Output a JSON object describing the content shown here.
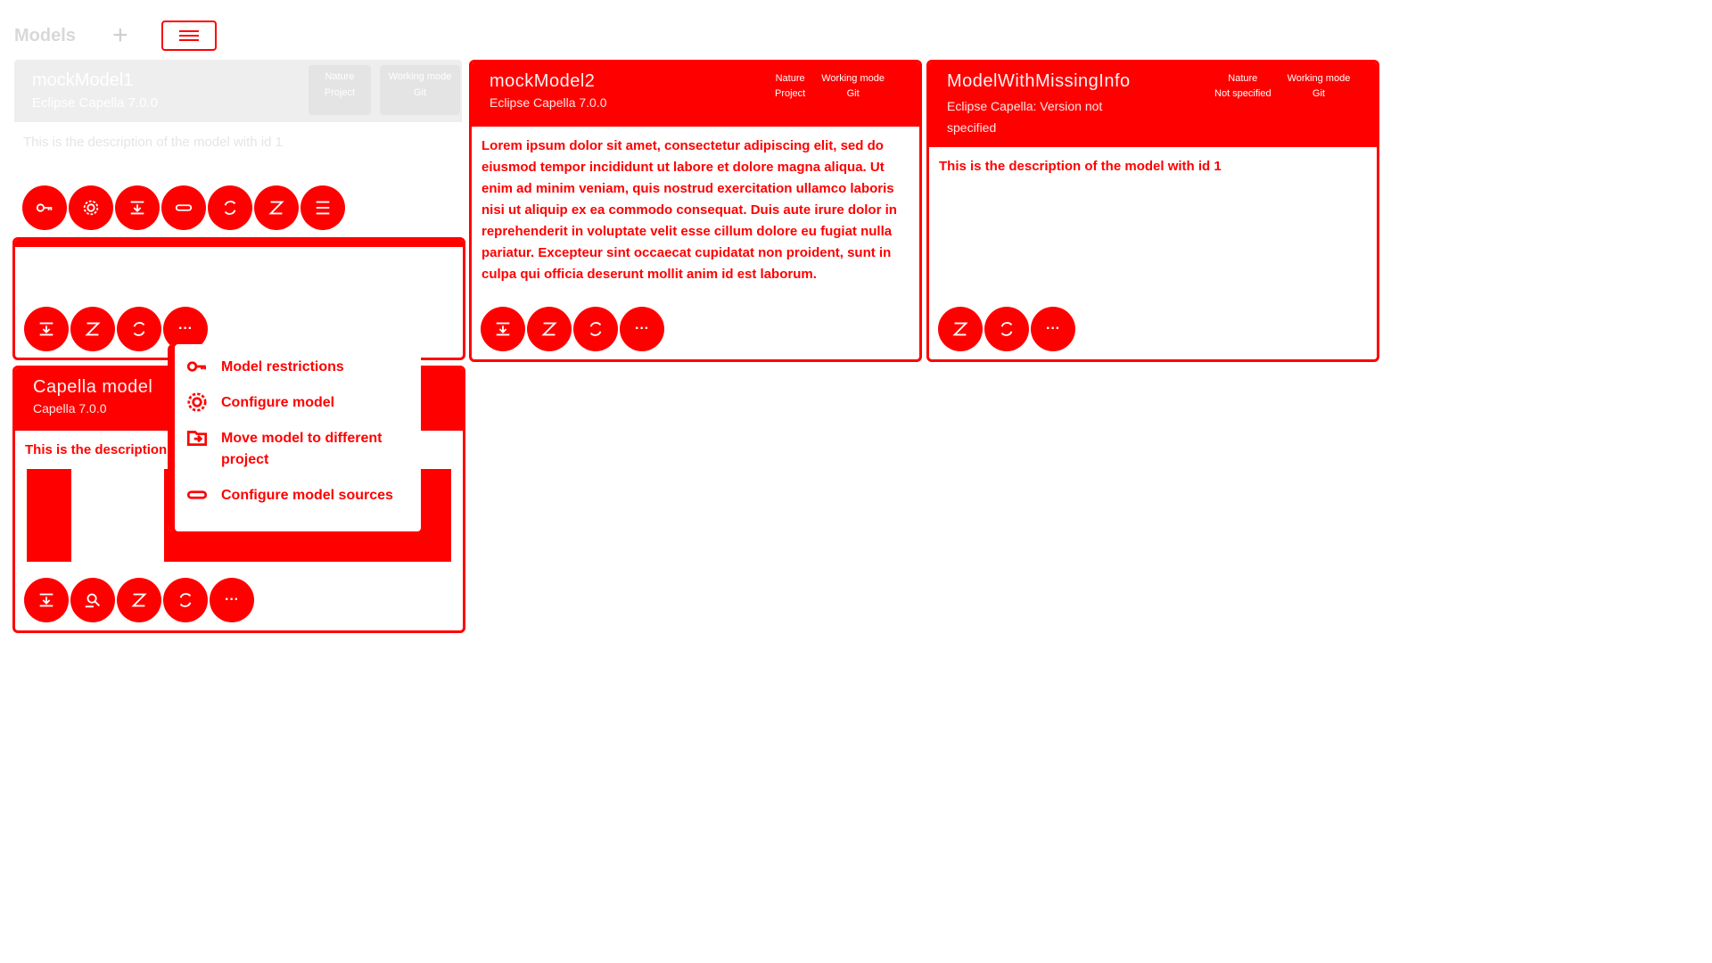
{
  "header": {
    "title": "Models",
    "add_label": "+"
  },
  "cards": [
    {
      "title": "mockModel1",
      "subtitle": "Eclipse Capella 7.0.0",
      "nature_label": "Nature",
      "nature_value": "Project",
      "mode_label": "Working mode",
      "mode_value": "Git",
      "description": "This is the description of the model with id 1"
    },
    {
      "title": "mockModel2",
      "subtitle": "Eclipse Capella 7.0.0",
      "nature_label": "Nature",
      "nature_value": "Project",
      "mode_label": "Working mode",
      "mode_value": "Git",
      "description": "Lorem ipsum dolor sit amet, consectetur adipiscing elit, sed do eiusmod tempor incididunt ut labore et dolore magna aliqua. Ut enim ad minim veniam, quis nostrud exercitation ullamco laboris nisi ut aliquip ex ea commodo consequat. Duis aute irure dolor in reprehenderit in voluptate velit esse cillum dolore eu fugiat nulla pariatur. Excepteur sint occaecat cupidatat non proident, sunt in culpa qui officia deserunt mollit anim id est laborum."
    },
    {
      "title": "ModelWithMissingInfo",
      "subtitle": "Eclipse Capella: Version not specified",
      "nature_label": "Nature",
      "nature_value": "Not specified",
      "mode_label": "Working mode",
      "mode_value": "Git",
      "description": "This is the description of the model with id 1"
    },
    {
      "title": "Capella model",
      "subtitle": "Capella 7.0.0",
      "description": "This is the description"
    }
  ],
  "menu": {
    "items": [
      {
        "label": "Model restrictions",
        "icon": "key-icon"
      },
      {
        "label": "Configure model",
        "icon": "gear-icon"
      },
      {
        "label": "Move model to different project",
        "icon": "folder-move-icon"
      },
      {
        "label": "Configure model sources",
        "icon": "link-icon"
      }
    ]
  },
  "more_label": "···",
  "colors": {
    "accent": "#ff0000",
    "ghost": "#eeeeee"
  }
}
